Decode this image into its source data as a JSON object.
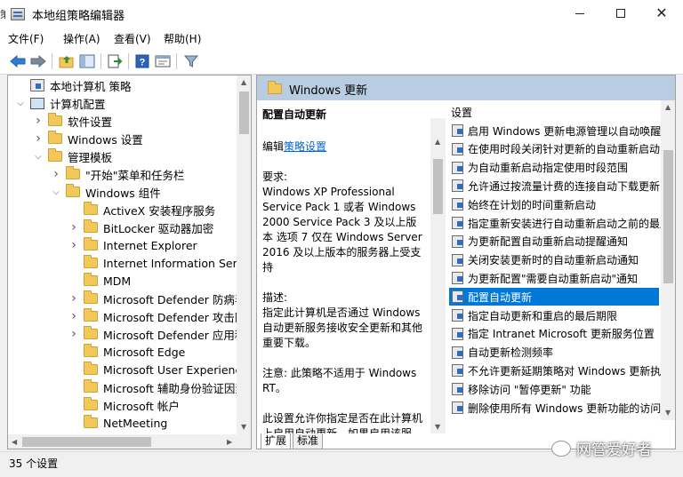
{
  "window": {
    "title": "本地组策略编辑器",
    "edge_mark": "策"
  },
  "menu": [
    "文件(F)",
    "操作(A)",
    "查看(V)",
    "帮助(H)"
  ],
  "toolbar": {
    "buttons": [
      "back-arrow-icon",
      "forward-arrow-icon",
      "up-folder-icon",
      "show-hide-tree-icon",
      "export-list-icon",
      "help-icon",
      "properties-icon",
      "filter-icon"
    ]
  },
  "tree": {
    "items": [
      {
        "label": "本地计算机 策略",
        "level": 0,
        "expander": "",
        "icon": "policy"
      },
      {
        "label": "计算机配置",
        "level": 0,
        "expander": "expanded",
        "icon": "pc"
      },
      {
        "label": "软件设置",
        "level": 1,
        "expander": "collapsed",
        "icon": "folder"
      },
      {
        "label": "Windows 设置",
        "level": 1,
        "expander": "collapsed",
        "icon": "folder"
      },
      {
        "label": "管理模板",
        "level": 1,
        "expander": "expanded",
        "icon": "folder"
      },
      {
        "label": "\"开始\"菜单和任务栏",
        "level": 2,
        "expander": "collapsed",
        "icon": "folder"
      },
      {
        "label": "Windows 组件",
        "level": 2,
        "expander": "expanded",
        "icon": "folder"
      },
      {
        "label": "ActiveX 安装程序服务",
        "level": 3,
        "expander": "",
        "icon": "folder"
      },
      {
        "label": "BitLocker 驱动器加密",
        "level": 3,
        "expander": "collapsed",
        "icon": "folder"
      },
      {
        "label": "Internet Explorer",
        "level": 3,
        "expander": "collapsed",
        "icon": "folder"
      },
      {
        "label": "Internet Information Servic",
        "level": 3,
        "expander": "",
        "icon": "folder"
      },
      {
        "label": "MDM",
        "level": 3,
        "expander": "",
        "icon": "folder"
      },
      {
        "label": "Microsoft Defender 防病毒",
        "level": 3,
        "expander": "collapsed",
        "icon": "folder"
      },
      {
        "label": "Microsoft Defender 攻击防",
        "level": 3,
        "expander": "collapsed",
        "icon": "folder"
      },
      {
        "label": "Microsoft Defender 应用程",
        "level": 3,
        "expander": "collapsed",
        "icon": "folder"
      },
      {
        "label": "Microsoft Edge",
        "level": 3,
        "expander": "",
        "icon": "folder"
      },
      {
        "label": "Microsoft User Experience",
        "level": 3,
        "expander": "",
        "icon": "folder"
      },
      {
        "label": "Microsoft 辅助身份验证因素",
        "level": 3,
        "expander": "",
        "icon": "folder"
      },
      {
        "label": "Microsoft 帐户",
        "level": 3,
        "expander": "",
        "icon": "folder"
      },
      {
        "label": "NetMeeting",
        "level": 3,
        "expander": "",
        "icon": "folder"
      }
    ]
  },
  "details": {
    "header": "Windows 更新",
    "policy_title": "配置自动更新",
    "edit_prefix": "编辑",
    "edit_link": "策略设置",
    "requirements_label": "要求:",
    "requirements_text": "Windows XP Professional Service Pack 1 或者 Windows 2000 Service Pack 3 及以上版本 选项 7 仅在 Windows Server 2016 及以上版本的服务器上受支持",
    "description_label": "描述:",
    "description_text": "指定此计算机是否通过 Windows 自动更新服务接收安全更新和其他重要下载。",
    "note_text": "注意: 此策略不适用于 Windows RT。",
    "more_text": "此设置允许你指定是否在此计算机上启用自动更新。如果启用该服"
  },
  "settings": {
    "column_header": "设置",
    "items": [
      "启用 Windows 更新电源管理以自动唤醒",
      "在使用时段关闭针对更新的自动重新启动",
      "为自动重新启动指定使用时段范围",
      "允许通过按流量计费的连接自动下载更新",
      "始终在计划的时间重新启动",
      "指定重新安装进行自动重新启动之前的最后期限",
      "为更新配置自动重新启动提醒通知",
      "关闭安装更新时的自动重新启动通知",
      "为更新配置\"需要自动重新启动\"通知",
      "配置自动更新",
      "指定自动更新和重启的最后期限",
      "指定 Intranet Microsoft 更新服务位置",
      "自动更新检测频率",
      "不允许更新延期策略对 Windows 更新执行扫描",
      "移除访问 \"暂停更新\" 功能",
      "删除使用所有 Windows 更新功能的访问权限"
    ],
    "selected_index": 9
  },
  "tabs": [
    "扩展",
    "标准"
  ],
  "status": {
    "text": "35 个设置"
  },
  "watermark": "网管爱好者",
  "colors": {
    "selection": "#0078d7",
    "header_band": "#b8cde2",
    "link": "#0066cc"
  }
}
